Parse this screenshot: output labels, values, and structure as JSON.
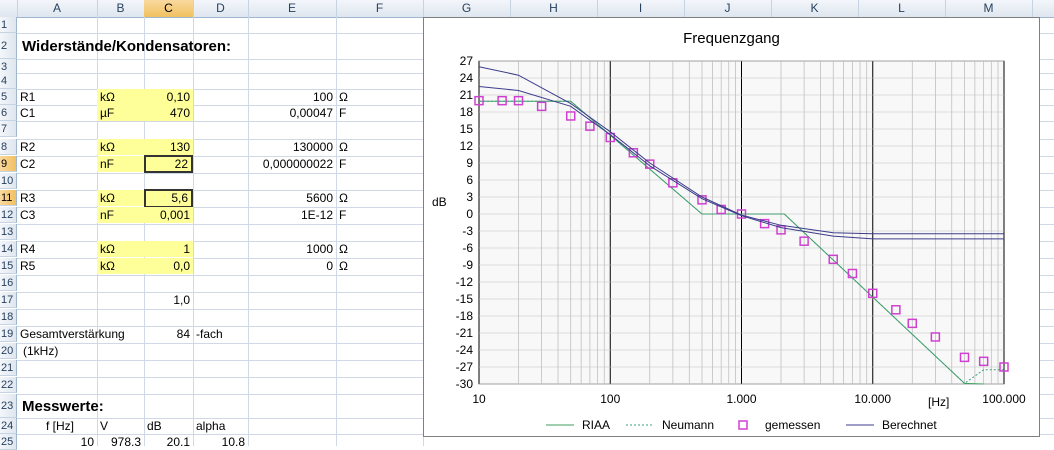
{
  "sheet": {
    "columns": [
      "A",
      "B",
      "C",
      "D",
      "E",
      "F",
      "G",
      "H",
      "I",
      "J",
      "K",
      "L",
      "M"
    ],
    "selected_column": "C",
    "rows": [
      "1",
      "2",
      "3",
      "4",
      "5",
      "6",
      "7",
      "8",
      "9",
      "10",
      "11",
      "12",
      "13",
      "14",
      "15",
      "16",
      "17",
      "18",
      "19",
      "20",
      "21",
      "22",
      "23",
      "24",
      "25"
    ],
    "selected_rows": [
      "9",
      "11"
    ]
  },
  "cells": {
    "heading": "Widerstände/Kondensatoren:",
    "r1": {
      "name": "R1",
      "unit": "kΩ",
      "value": "0,10",
      "abs": "100",
      "absunit": "Ω"
    },
    "c1": {
      "name": "C1",
      "unit": "µF",
      "value": "470",
      "abs": "0,00047",
      "absunit": "F"
    },
    "r2": {
      "name": "R2",
      "unit": "kΩ",
      "value": "130",
      "abs": "130000",
      "absunit": "Ω"
    },
    "c2": {
      "name": "C2",
      "unit": "nF",
      "value": "22",
      "abs": "0,000000022",
      "absunit": "F"
    },
    "r3": {
      "name": "R3",
      "unit": "kΩ",
      "value": "5,6",
      "abs": "5600",
      "absunit": "Ω"
    },
    "c3": {
      "name": "C3",
      "unit": "nF",
      "value": "0,001",
      "abs": "1E-12",
      "absunit": "F"
    },
    "r4": {
      "name": "R4",
      "unit": "kΩ",
      "value": "1",
      "abs": "1000",
      "absunit": "Ω"
    },
    "r5": {
      "name": "R5",
      "unit": "kΩ",
      "value": "0,0",
      "abs": "0",
      "absunit": "Ω"
    },
    "row17_value": "1,0",
    "gain_label": "Gesamtverstärkung",
    "gain_value": "84",
    "gain_unit": "-fach",
    "gain_note": "(1kHz)",
    "messwerte": "Messwerte:",
    "headers": [
      "f [Hz]",
      "V",
      "dB",
      "alpha"
    ],
    "row24": [
      "10",
      "978.3",
      "20.1",
      "10.8"
    ]
  },
  "chart_data": {
    "type": "line",
    "title": "Frequenzgang",
    "ylabel": "dB",
    "xlabel": "[Hz]",
    "x_scale": "log",
    "xlim": [
      10,
      100000
    ],
    "ylim": [
      -30,
      27
    ],
    "x_ticks": [
      "10",
      "100",
      "1.000",
      "10.000",
      "100.000"
    ],
    "y_ticks": [
      "27",
      "24",
      "21",
      "18",
      "15",
      "12",
      "9",
      "6",
      "3",
      "0",
      "-3",
      "-6",
      "-9",
      "-12",
      "-15",
      "-18",
      "-21",
      "-24",
      "-27",
      "-30"
    ],
    "grid": "log-minor-x, major-y",
    "legend_position": "bottom",
    "colors": {
      "RIAA": "#3f9f5f",
      "Neumann": "#3f9f7f",
      "gemessen": "#d040d0",
      "Berechnet": "#3c3c8c"
    },
    "series": [
      {
        "name": "RIAA",
        "style": "line",
        "x": [
          10,
          50,
          500,
          1000,
          2120,
          50000,
          70000
        ],
        "y": [
          19.9,
          19.9,
          0,
          0,
          0,
          -29.9,
          -30
        ]
      },
      {
        "name": "Neumann",
        "style": "dashed",
        "x": [
          10,
          50,
          500,
          1000,
          2120,
          50000,
          70000,
          100000
        ],
        "y": [
          19.9,
          19.9,
          0,
          0,
          0,
          -29.9,
          -27.5,
          -27.5
        ]
      },
      {
        "name": "gemessen",
        "style": "marker",
        "x": [
          10,
          15,
          20,
          30,
          50,
          70,
          100,
          150,
          200,
          300,
          500,
          700,
          1000,
          1500,
          2000,
          3000,
          5000,
          7000,
          10000,
          15000,
          20000,
          30000,
          50000,
          70000,
          100000
        ],
        "y": [
          20,
          20,
          20,
          19,
          17.3,
          15.5,
          13.5,
          10.8,
          8.8,
          5.5,
          2.5,
          0.8,
          0,
          -1.7,
          -2.8,
          -4.8,
          -8,
          -10.5,
          -14,
          -16.9,
          -19.3,
          -21.7,
          -25.3,
          -26,
          -27
        ]
      },
      {
        "name": "Berechnet",
        "style": "line",
        "x": [
          10,
          20,
          50,
          100,
          200,
          500,
          1000,
          2000,
          5000,
          10000,
          100000
        ],
        "y": [
          26,
          24.5,
          19.5,
          14.5,
          9,
          3,
          -0.2,
          -2,
          -3.3,
          -3.5,
          -3.5
        ]
      },
      {
        "name": "Berechnet",
        "style": "line",
        "x": [
          10,
          20,
          50,
          100,
          200,
          500,
          1000,
          2000,
          5000,
          10000,
          100000
        ],
        "y": [
          22.5,
          21.8,
          19,
          14,
          8.5,
          2.7,
          -0.3,
          -2.4,
          -3.9,
          -4.4,
          -4.4
        ]
      }
    ]
  }
}
